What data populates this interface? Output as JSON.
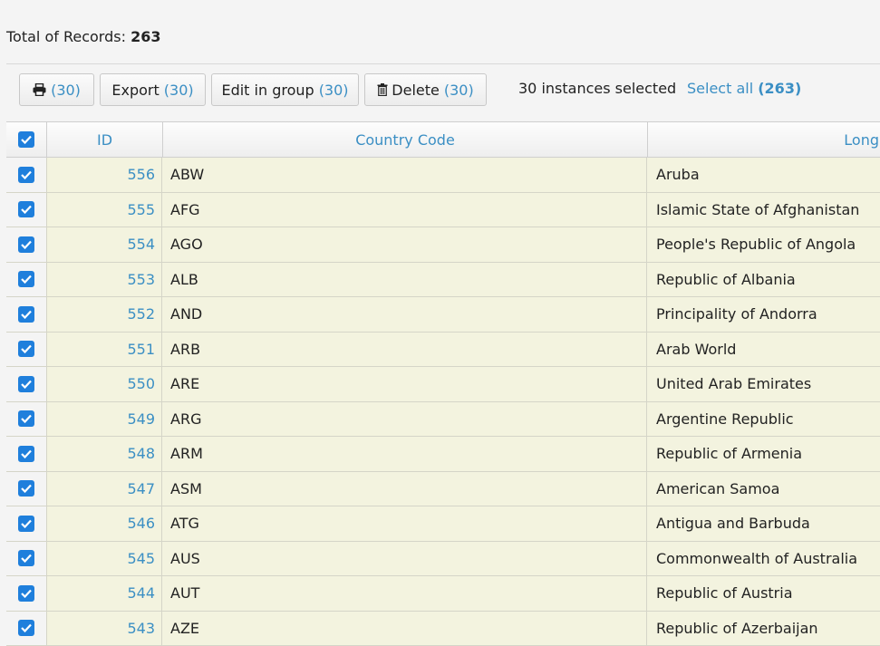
{
  "summary": {
    "label": "Total of Records:",
    "value": "263"
  },
  "toolbar": {
    "print_count": "(30)",
    "export_label": "Export",
    "export_count": "(30)",
    "edit_label": "Edit in group",
    "edit_count": "(30)",
    "delete_label": "Delete",
    "delete_count": "(30)",
    "selection_text": "30 instances selected",
    "select_all_label": "Select all",
    "select_all_count": "(263)"
  },
  "columns": {
    "id": "ID",
    "code": "Country Code",
    "long": "Long"
  },
  "rows": [
    {
      "id": "556",
      "code": "ABW",
      "long": "Aruba",
      "checked": true
    },
    {
      "id": "555",
      "code": "AFG",
      "long": "Islamic State of Afghanistan",
      "checked": true
    },
    {
      "id": "554",
      "code": "AGO",
      "long": "People's Republic of Angola",
      "checked": true
    },
    {
      "id": "553",
      "code": "ALB",
      "long": "Republic of Albania",
      "checked": true
    },
    {
      "id": "552",
      "code": "AND",
      "long": "Principality of Andorra",
      "checked": true
    },
    {
      "id": "551",
      "code": "ARB",
      "long": "Arab World",
      "checked": true
    },
    {
      "id": "550",
      "code": "ARE",
      "long": "United Arab Emirates",
      "checked": true
    },
    {
      "id": "549",
      "code": "ARG",
      "long": "Argentine Republic",
      "checked": true
    },
    {
      "id": "548",
      "code": "ARM",
      "long": "Republic of Armenia",
      "checked": true
    },
    {
      "id": "547",
      "code": "ASM",
      "long": "American Samoa",
      "checked": true
    },
    {
      "id": "546",
      "code": "ATG",
      "long": "Antigua and Barbuda",
      "checked": true
    },
    {
      "id": "545",
      "code": "AUS",
      "long": "Commonwealth of Australia",
      "checked": true
    },
    {
      "id": "544",
      "code": "AUT",
      "long": "Republic of Austria",
      "checked": true
    },
    {
      "id": "543",
      "code": "AZE",
      "long": "Republic of Azerbaijan",
      "checked": true
    }
  ],
  "colors": {
    "accent": "#3b8fc4",
    "checkbox": "#1f7fdc",
    "row_bg": "#f3f3df"
  }
}
